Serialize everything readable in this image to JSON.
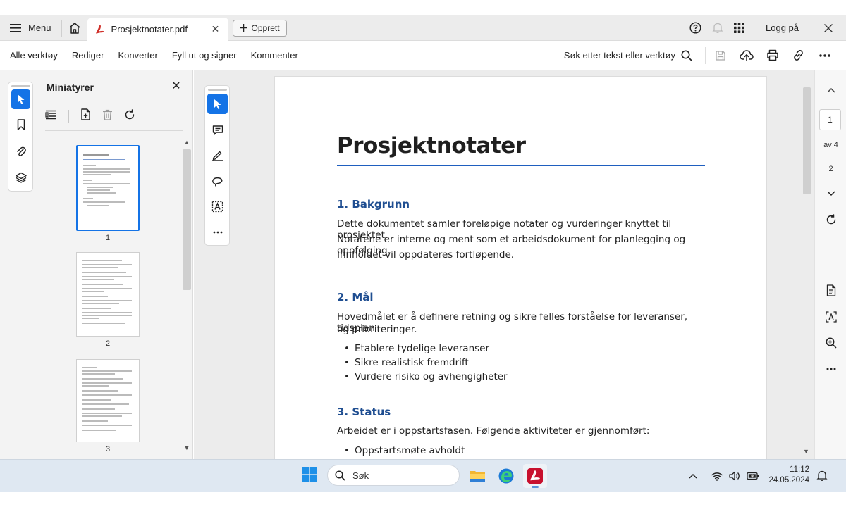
{
  "titlebar": {
    "menu_label": "Menu",
    "tab_title": "Prosjektnotater.pdf",
    "create_label": "Opprett",
    "login_label": "Logg på"
  },
  "toolbar": {
    "items": [
      "Alle verktøy",
      "Rediger",
      "Konverter",
      "Fyll ut og signer",
      "Kommenter"
    ],
    "search_label": "Søk etter tekst eller verktøy"
  },
  "thumbnails": {
    "title": "Miniatyrer",
    "pages": [
      "1",
      "2",
      "3"
    ]
  },
  "document": {
    "title": "Prosjektnotater",
    "sections": [
      {
        "heading": "1. Bakgrunn",
        "paragraph_lines": [
          "Dette dokumentet samler foreløpige notater og vurderinger knyttet til prosjektet.",
          "Notatene er interne og ment som et arbeidsdokument for planlegging og oppfølging.",
          "Innholdet vil oppdateres fortløpende."
        ]
      },
      {
        "heading": "2. Mål",
        "paragraph_lines": [
          "Hovedmålet er å definere retning og sikre felles forståelse for leveranser, tidsplan",
          "og prioriteringer."
        ],
        "bullets": [
          "Etablere tydelige leveranser",
          "Sikre realistisk fremdrift",
          "Vurdere risiko og avhengigheter"
        ]
      },
      {
        "heading": "3. Status",
        "paragraph_lines": [
          "Arbeidet er i oppstartsfasen. Følgende aktiviteter er gjennomført:"
        ],
        "bullets": [
          "Oppstartsmøte avholdt"
        ]
      }
    ]
  },
  "pager": {
    "current_page": "1",
    "total_label": "av 4",
    "next_page": "2"
  },
  "taskbar": {
    "search_placeholder": "Søk",
    "time": "11:12",
    "date": "24.05.2024"
  },
  "colors": {
    "accent": "#1473e6",
    "heading_blue": "#1f4e91",
    "acrobat_red": "#c8102e"
  }
}
